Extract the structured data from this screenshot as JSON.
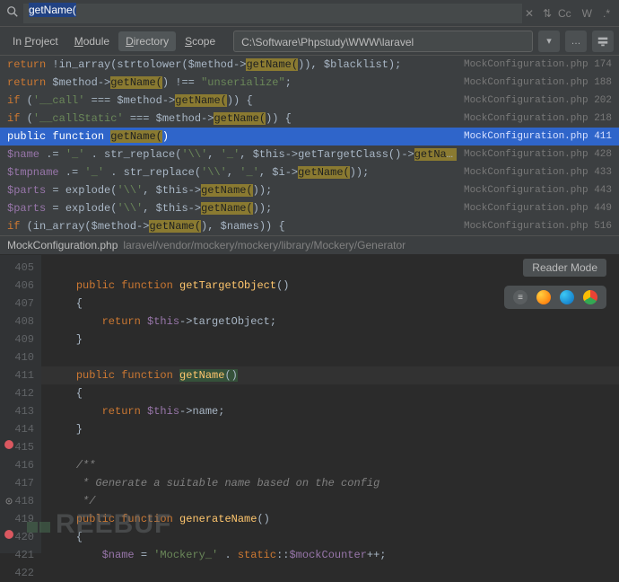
{
  "search": {
    "query": "getName(",
    "tools": [
      "Cc",
      "W",
      ".*"
    ]
  },
  "scope": {
    "items": [
      {
        "pre": "In ",
        "ul": "P",
        "post": "roject",
        "active": false
      },
      {
        "pre": "",
        "ul": "M",
        "post": "odule",
        "active": false
      },
      {
        "pre": "",
        "ul": "D",
        "post": "irectory",
        "active": true
      },
      {
        "pre": "",
        "ul": "S",
        "post": "cope",
        "active": false
      }
    ],
    "path": "C:\\Software\\Phpstudy\\WWW\\laravel"
  },
  "results": [
    {
      "selected": false,
      "html": "<span class='k-ret'>return</span> <span class='k-pl'>!in_array(strtolower($method-></span><span class='k-hl-y'>getName(</span><span class='k-pl'>)), $blacklist);</span>",
      "file": "MockConfiguration.php",
      "line": "174"
    },
    {
      "selected": false,
      "html": "<span class='k-ret'>return</span> <span class='k-pl'>$method-></span><span class='k-hl-y'>getName(</span><span class='k-pl'>) !== </span><span class='k-str'>\"unserialize\"</span><span class='k-pl'>;</span>",
      "file": "MockConfiguration.php",
      "line": "188"
    },
    {
      "selected": false,
      "html": "<span class='k-key'>if</span> <span class='k-pl'>(</span><span class='k-str'>'__call'</span><span class='k-pl'> === $method-></span><span class='k-hl-y'>getName(</span><span class='k-pl'>)) {</span>",
      "file": "MockConfiguration.php",
      "line": "202"
    },
    {
      "selected": false,
      "html": "<span class='k-key'>if</span> <span class='k-pl'>(</span><span class='k-str'>'__callStatic'</span><span class='k-pl'> === $method-></span><span class='k-hl-y'>getName(</span><span class='k-pl'>)) {</span>",
      "file": "MockConfiguration.php",
      "line": "218"
    },
    {
      "selected": true,
      "html": "<span class='k-key'>public function</span> <span class='k-hl-y'>getName(</span><span class='k-pl'>)</span>",
      "file": "MockConfiguration.php",
      "line": "411"
    },
    {
      "selected": false,
      "html": "<span class='k-var'>$name</span><span class='k-pl'> .= </span><span class='k-str'>'_'</span><span class='k-pl'> . str_replace(</span><span class='k-str'>'\\\\'</span><span class='k-pl'>, </span><span class='k-str'>'_'</span><span class='k-pl'>, $this->getTargetClass()-></span><span class='k-hl-y'>getName(</span><span class='k-pl'>));</span>",
      "file": "MockConfiguration.php",
      "line": "428"
    },
    {
      "selected": false,
      "html": "<span class='k-var'>$tmpname</span><span class='k-pl'> .= </span><span class='k-str'>'_'</span><span class='k-pl'> . str_replace(</span><span class='k-str'>'\\\\'</span><span class='k-pl'>, </span><span class='k-str'>'_'</span><span class='k-pl'>, $i-></span><span class='k-hl-y'>getName(</span><span class='k-pl'>));</span>",
      "file": "MockConfiguration.php",
      "line": "433"
    },
    {
      "selected": false,
      "html": "<span class='k-var'>$parts</span><span class='k-pl'> = explode(</span><span class='k-str'>'\\\\'</span><span class='k-pl'>, $this-></span><span class='k-hl-y'>getName(</span><span class='k-pl'>));</span>",
      "file": "MockConfiguration.php",
      "line": "443"
    },
    {
      "selected": false,
      "html": "<span class='k-var'>$parts</span><span class='k-pl'> = explode(</span><span class='k-str'>'\\\\'</span><span class='k-pl'>, $this-></span><span class='k-hl-y'>getName(</span><span class='k-pl'>));</span>",
      "file": "MockConfiguration.php",
      "line": "449"
    },
    {
      "selected": false,
      "html": "<span class='k-key'>if</span><span class='k-pl'> (in_array($method-></span><span class='k-hl-y'>getName(</span><span class='k-pl'>), $names)) {</span>",
      "file": "MockConfiguration.php",
      "line": "516"
    }
  ],
  "preview": {
    "filename": "MockConfiguration.php",
    "subpath": "laravel/vendor/mockery/mockery/library/Mockery/Generator",
    "reader_mode": "Reader Mode"
  },
  "code": {
    "start": 405,
    "lines": [
      {
        "n": 405,
        "html": ""
      },
      {
        "n": 406,
        "html": "    <span class='k-key'>public function</span> <span class='k-fn'>getTargetObject</span>()"
      },
      {
        "n": 407,
        "html": "    {"
      },
      {
        "n": 408,
        "html": "        <span class='k-key'>return</span> <span class='k-var'>$this</span>-&gt;targetObject;"
      },
      {
        "n": 409,
        "html": "    }"
      },
      {
        "n": 410,
        "html": ""
      },
      {
        "n": 411,
        "caret": true,
        "html": "    <span class='k-key'>public function</span> <span class='k-fn hl-def'>getName</span><span class='hl-def'>()</span>"
      },
      {
        "n": 412,
        "html": "    {"
      },
      {
        "n": 413,
        "html": "        <span class='k-key'>return</span> <span class='k-var'>$this</span>-&gt;name;"
      },
      {
        "n": 414,
        "html": "    }"
      },
      {
        "n": 415,
        "html": ""
      },
      {
        "n": 416,
        "html": "    <span class='k-cm'>/**</span>"
      },
      {
        "n": 417,
        "html": "    <span class='k-cm'> * Generate a suitable name based on the config</span>"
      },
      {
        "n": 418,
        "html": "    <span class='k-cm'> */</span>"
      },
      {
        "n": 419,
        "html": "    <span class='k-key'>public function</span> <span class='k-fn'>generateName</span>()"
      },
      {
        "n": 420,
        "html": "    {"
      },
      {
        "n": 421,
        "html": "        <span class='k-var'>$name</span> = <span class='k-str'>'Mockery_'</span> . <span class='k-key'>static</span>::<span class='k-var'>$mockCounter</span>++;"
      },
      {
        "n": 422,
        "html": ""
      }
    ]
  },
  "watermark": "REEBUF"
}
